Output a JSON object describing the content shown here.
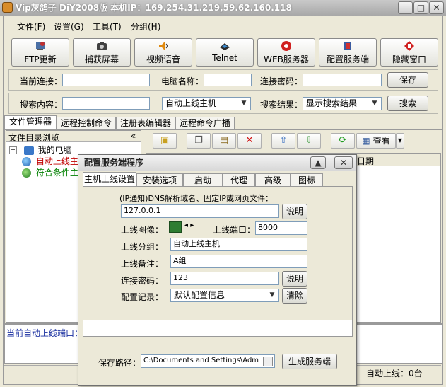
{
  "window": {
    "title": "Vip灰鸽子 DiY2008版   本机IP：169.254.31.219,59.62.160.118"
  },
  "menu": {
    "items": [
      "文件(F)",
      "设置(G)",
      "工具(T)",
      "分组(H)"
    ]
  },
  "toolbar": {
    "buttons": [
      {
        "label": "FTP更新",
        "icon": "ftp-update-icon",
        "color": "#c03030"
      },
      {
        "label": "捕获屏幕",
        "icon": "camera-icon",
        "color": "#404040"
      },
      {
        "label": "视频语音",
        "icon": "speaker-icon",
        "color": "#e08a10"
      },
      {
        "label": "Telnet",
        "icon": "telnet-icon",
        "color": "#2a2a2a"
      },
      {
        "label": "WEB服务器",
        "icon": "web-server-icon",
        "color": "#d02020"
      },
      {
        "label": "配置服务端",
        "icon": "configure-icon",
        "color": "#d03030"
      },
      {
        "label": "隐藏窗口",
        "icon": "hide-window-icon",
        "color": "#d02020"
      }
    ]
  },
  "connection": {
    "current_label": "当前连接：",
    "current_value": "",
    "computer_label": "电脑名称：",
    "computer_value": "",
    "password_label": "连接密码：",
    "password_value": "",
    "save_label": "保存"
  },
  "search": {
    "content_label": "搜索内容：",
    "content_value": "",
    "type_value": "自动上线主机",
    "result_label": "搜索结果：",
    "result_value": "显示搜索结果",
    "button_label": "搜索"
  },
  "main_tabs": [
    "文件管理器",
    "远程控制命令",
    "注册表编辑器",
    "远程命令广播"
  ],
  "tree": {
    "header": "文件目录浏览",
    "collapse": "«",
    "items": [
      {
        "label": "我的电脑",
        "color": "#000000"
      },
      {
        "label": "自动上线主",
        "color": "#c00000"
      },
      {
        "label": "符合条件主",
        "color": "#008000"
      }
    ]
  },
  "file_tools": {
    "view_label": "查看"
  },
  "list": {
    "date_header": "日期"
  },
  "bottom": {
    "port_text": "当前自动上线端口：",
    "auto_online_text": "自动上线：0台"
  },
  "dialog": {
    "title": "配置服务端程序",
    "tabs": [
      "主机上线设置",
      "安装选项",
      "启动",
      "代理",
      "高级",
      "图标"
    ],
    "dns_label": "(IP通知)DNS解析域名、固定IP或网页文件：",
    "dns_value": "127.0.0.1",
    "explain_label": "说明",
    "image_label": "上线图像：",
    "port_label": "上线端口：",
    "port_value": "8000",
    "group_label": "上线分组：",
    "group_value": "自动上线主机",
    "note_label": "上线备注：",
    "note_value": "A组",
    "password_label": "连接密码：",
    "password_value": "123",
    "password_explain": "说明",
    "config_label": "配置记录：",
    "config_value": "默认配置信息",
    "clear_label": "清除",
    "save_path_label": "保存路径：",
    "save_path_value": "C:\\Documents and Settings\\Adm",
    "generate_label": "生成服务端"
  }
}
